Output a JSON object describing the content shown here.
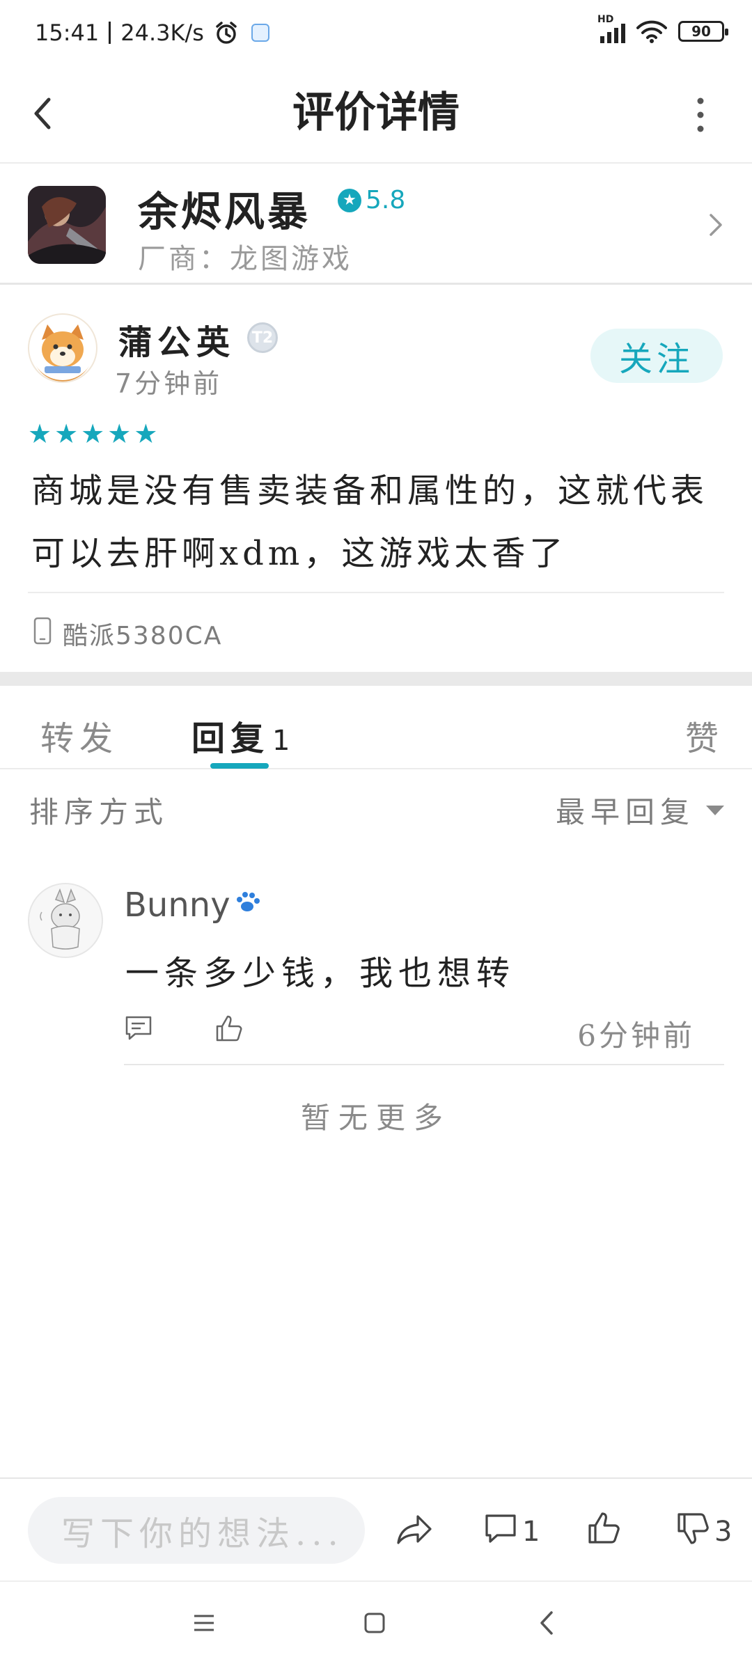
{
  "status_bar": {
    "time": "15:41",
    "net_speed": "24.3K/s",
    "network": "HD",
    "battery": "90"
  },
  "header": {
    "title": "评价详情"
  },
  "game": {
    "title": "余烬风暴",
    "score": "5.8",
    "vendor_label": "厂商：",
    "vendor": "龙图游戏"
  },
  "review": {
    "username": "蒲公英",
    "level": "T2",
    "time": "7分钟前",
    "follow_label": "关注",
    "rating": 5,
    "text": "商城是没有售卖装备和属性的，这就代表可以去肝啊xdm，这游戏太香了",
    "device": "酷派5380CA"
  },
  "tabs": {
    "forward": "转发",
    "reply": "回复",
    "reply_count": "1",
    "like": "赞"
  },
  "sort": {
    "label": "排序方式",
    "selected": "最早回复"
  },
  "comment": {
    "username": "Bunny",
    "text": "一条多少钱，我也想转",
    "time": "6分钟前"
  },
  "no_more": "暂无更多",
  "bottom_bar": {
    "input_placeholder": "写下你的想法...",
    "comment_count": "1",
    "dislike_count": "3"
  },
  "colors": {
    "accent": "#16a7bc",
    "follow_bg": "#e6f7f8",
    "text": "#222222",
    "muted": "#8a8a8a"
  },
  "icons": [
    "back-arrow-icon",
    "more-vertical-icon",
    "alarm-icon",
    "chevron-right-icon",
    "star-icon",
    "phone-icon",
    "paw-icon",
    "comment-icon",
    "thumb-up-icon",
    "share-icon",
    "thumb-down-icon",
    "menu-icon",
    "home-icon",
    "nav-back-icon"
  ]
}
